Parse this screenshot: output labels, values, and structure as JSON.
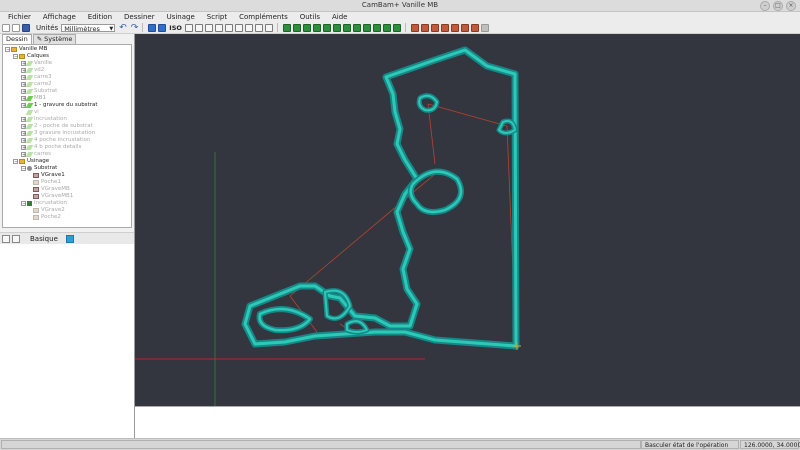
{
  "window": {
    "title": "CamBam+ Vanille MB"
  },
  "menu": [
    "Fichier",
    "Affichage",
    "Edition",
    "Dessiner",
    "Usinage",
    "Script",
    "Compléments",
    "Outils",
    "Aide"
  ],
  "toolbar": {
    "units_label": "Unités",
    "units_value": "Millimètres",
    "iso_label": "ISO"
  },
  "tabs": {
    "dessin": "Dessin",
    "systeme": "Système"
  },
  "tree": {
    "root": "Vanille MB",
    "calques": "Calques",
    "layers": [
      "Vanille",
      "vd2",
      "carre3",
      "carre2",
      "Substrat",
      "MB1",
      "1 - gravure du substrat",
      "vi",
      "Incrustation",
      "2 - poche de substrat",
      "3 gravure incrustation",
      "4 poche incrustation",
      "4 b poche details",
      "carres"
    ],
    "usinage": "Usinage",
    "substrat": "Substrat",
    "substrat_ops": [
      "VGrave1",
      "Poche1",
      "VGraveMB",
      "VGraveMB1"
    ],
    "incrustation": "Incrustation",
    "incrustation_ops": [
      "VGrave2",
      "Poche2"
    ]
  },
  "properties": {
    "mode_label": "Basique"
  },
  "status": {
    "message": "Basculer état de l'opération",
    "coords": "126.0000, 34.0000"
  },
  "colors": {
    "canvas_bg": "#33363f",
    "outline": "#1aa6a0",
    "toolpath": "#b8442e",
    "axis_x": "#b02a2a",
    "axis_y": "#2a7a2a"
  }
}
